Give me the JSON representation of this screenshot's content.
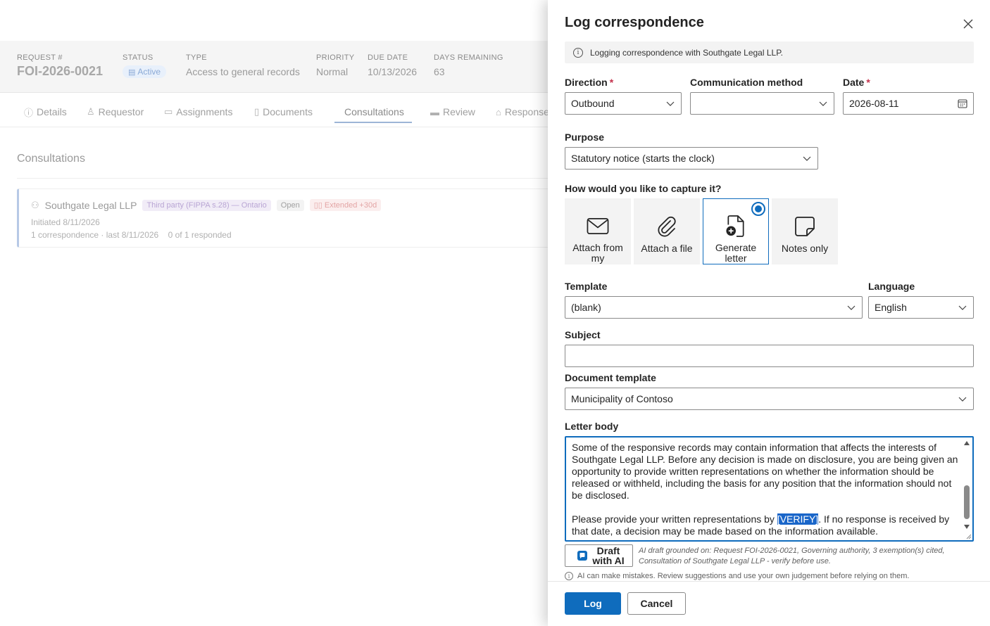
{
  "background": {
    "request_label": "REQUEST #",
    "request_number": "FOI-2026-0021",
    "status_label": "STATUS",
    "status_value": "Active",
    "type_label": "TYPE",
    "type_value": "Access to general records",
    "priority_label": "PRIORITY",
    "priority_value": "Normal",
    "due_label": "DUE DATE",
    "due_value": "10/13/2026",
    "days_label": "DAYS REMAINING",
    "days_value": "63",
    "tabs": [
      "Details",
      "Requestor",
      "Assignments",
      "Documents",
      "Consultations",
      "Review",
      "Response"
    ],
    "active_tab": "Consultations",
    "section_title": "Consultations",
    "consultation": {
      "party": "Southgate Legal LLP",
      "basis": "Third party (FIPPA s.28) — Ontario",
      "state": "Open",
      "extension": "Extended +30d",
      "initiated": "Initiated 8/11/2026",
      "correspondence": "1 correspondence · last 8/11/2026",
      "responded": "0 of 1 responded"
    }
  },
  "panel": {
    "title": "Log correspondence",
    "info": "Logging correspondence with Southgate Legal LLP.",
    "direction_label": "Direction",
    "direction_value": "Outbound",
    "method_label": "Communication method",
    "method_value": "",
    "date_label": "Date",
    "date_value": "2026-08-11",
    "purpose_label": "Purpose",
    "purpose_value": "Statutory notice (starts the clock)",
    "capture_label": "How would you like to capture it?",
    "capture_options": [
      {
        "label": "Attach from my",
        "icon": "mail-icon"
      },
      {
        "label": "Attach a file",
        "icon": "paperclip-icon"
      },
      {
        "label": "Generate letter",
        "icon": "document-add-icon"
      },
      {
        "label": "Notes only",
        "icon": "note-icon"
      }
    ],
    "capture_selected": "Generate letter",
    "template_label": "Template",
    "template_value": "(blank)",
    "language_label": "Language",
    "language_value": "English",
    "subject_label": "Subject",
    "subject_value": "",
    "doc_template_label": "Document template",
    "doc_template_value": "Municipality of Contoso",
    "letter_label": "Letter body",
    "letter_p1": "Some of the responsive records may contain information that affects the interests of Southgate Legal LLP. Before any decision is made on disclosure, you are being given an opportunity to provide written representations on whether the information should be released or withheld, including the basis for any position that the information should not be disclosed.",
    "letter_p2_before": "Please provide your written representations by ",
    "letter_p2_highlight": "[VERIFY]",
    "letter_p2_after": ". If no response is received by that date, a decision may be made based on the information available.",
    "ai_button": "Draft with AI",
    "ai_note": "AI draft grounded on: Request FOI-2026-0021, Governing authority, 3 exemption(s) cited, Consultation of Southgate Legal LLP - verify before use.",
    "disclaimer": "AI can make mistakes. Review suggestions and use your own judgement before relying on them.",
    "log_button": "Log",
    "cancel_button": "Cancel"
  },
  "colors": {
    "accent": "#0f6cbd",
    "required": "#c4314b",
    "highlight": "#1a66c9"
  }
}
